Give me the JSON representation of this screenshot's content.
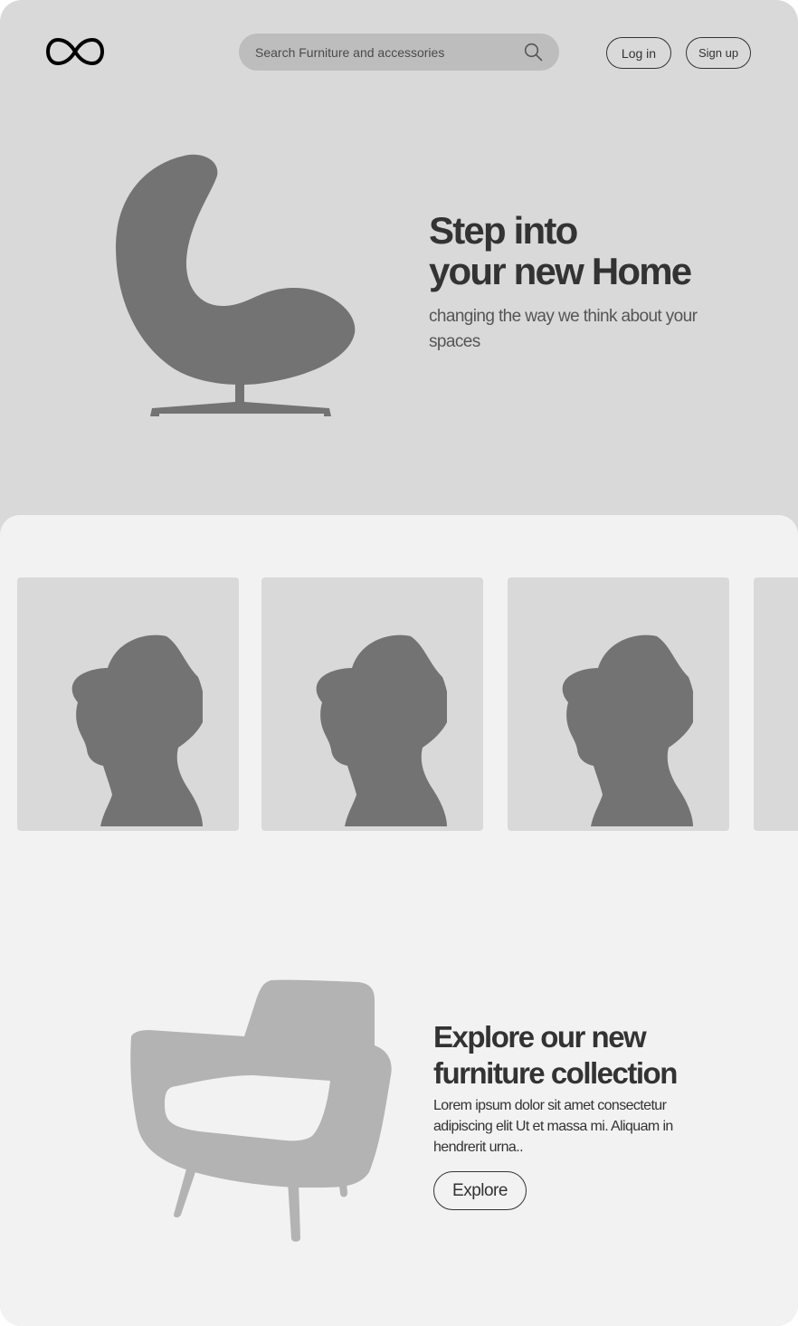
{
  "header": {
    "logo_icon": "infinity-logo-icon",
    "search": {
      "placeholder": "Search Furniture and accessories",
      "value": "",
      "icon": "search-icon"
    },
    "login_label": "Log in",
    "signup_label": "Sign up"
  },
  "hero": {
    "title_line1": "Step into",
    "title_line2": "your new Home",
    "subtitle": "changing the way we think about your spaces",
    "image_icon": "egg-chair-icon"
  },
  "carousel": {
    "cards": [
      {
        "image_icon": "person-silhouette-icon"
      },
      {
        "image_icon": "person-silhouette-icon"
      },
      {
        "image_icon": "person-silhouette-icon"
      },
      {
        "image_icon": ""
      }
    ]
  },
  "explore": {
    "title_line1": "Explore our new",
    "title_line2": "furniture collection",
    "text": "Lorem ipsum dolor sit amet consectetur adipiscing elit Ut et massa mi. Aliquam in hendrerit urna..",
    "button_label": "Explore",
    "image_icon": "armchair-icon"
  },
  "colors": {
    "hero_bg": "#d9d9d9",
    "panel_bg": "#f2f2f2",
    "search_bg": "#bdbdbd",
    "text_dark": "#333333",
    "text_muted": "#555555",
    "silhouette": "#737373",
    "armchair": "#b3b3b3"
  }
}
